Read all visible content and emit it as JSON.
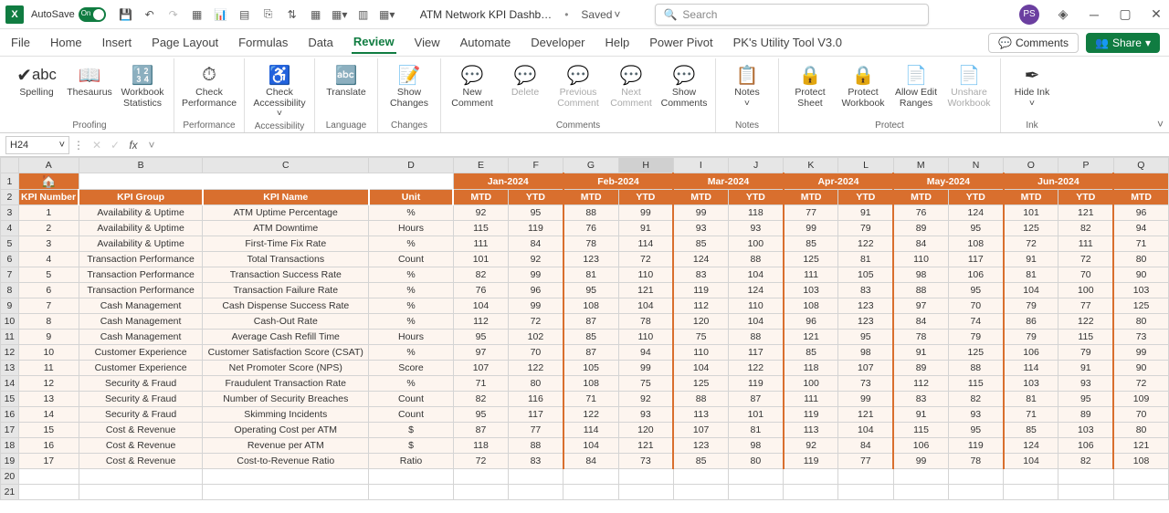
{
  "titlebar": {
    "autosave_label": "AutoSave",
    "autosave_on": "On",
    "doc_title": "ATM Network KPI Dashb…",
    "saved_status": "Saved",
    "search_placeholder": "Search",
    "avatar_initials": "PS"
  },
  "ribbon_tabs": [
    "File",
    "Home",
    "Insert",
    "Page Layout",
    "Formulas",
    "Data",
    "Review",
    "View",
    "Automate",
    "Developer",
    "Help",
    "Power Pivot",
    "PK's Utility Tool V3.0"
  ],
  "ribbon_active_tab": "Review",
  "ribbon_right": {
    "comments": "Comments",
    "share": "Share"
  },
  "ribbon_groups": {
    "proofing": {
      "label": "Proofing",
      "spelling": "Spelling",
      "thesaurus": "Thesaurus",
      "wbstats": "Workbook Statistics"
    },
    "performance": {
      "label": "Performance",
      "check_perf": "Check Performance"
    },
    "accessibility": {
      "label": "Accessibility",
      "check_acc": "Check Accessibility"
    },
    "language": {
      "label": "Language",
      "translate": "Translate"
    },
    "changes": {
      "label": "Changes",
      "show_changes": "Show Changes"
    },
    "comments": {
      "label": "Comments",
      "new": "New Comment",
      "delete": "Delete",
      "prev": "Previous Comment",
      "next": "Next Comment",
      "show": "Show Comments"
    },
    "notes": {
      "label": "Notes",
      "notes": "Notes"
    },
    "protect": {
      "label": "Protect",
      "sheet": "Protect Sheet",
      "workbook": "Protect Workbook",
      "ranges": "Allow Edit Ranges",
      "unshare": "Unshare Workbook"
    },
    "ink": {
      "label": "Ink",
      "hide": "Hide Ink"
    }
  },
  "formula_bar": {
    "name_box": "H24",
    "formula": ""
  },
  "columns": [
    "A",
    "B",
    "C",
    "D",
    "E",
    "F",
    "G",
    "H",
    "I",
    "J",
    "K",
    "L",
    "M",
    "N",
    "O",
    "P",
    "Q"
  ],
  "active_column": "H",
  "months": [
    "Jan-2024",
    "Feb-2024",
    "Mar-2024",
    "Apr-2024",
    "May-2024",
    "Jun-2024"
  ],
  "sub_headers": {
    "mtd": "MTD",
    "ytd": "YTD"
  },
  "headers": {
    "kpi_number": "KPI Number",
    "kpi_group": "KPI Group",
    "kpi_name": "KPI Name",
    "unit": "Unit"
  },
  "rows": [
    {
      "n": 1,
      "num": "1",
      "group": "Availability & Uptime",
      "name": "ATM Uptime Percentage",
      "unit": "%",
      "v": [
        "92",
        "95",
        "88",
        "99",
        "99",
        "118",
        "77",
        "91",
        "76",
        "124",
        "101",
        "121",
        "96"
      ]
    },
    {
      "n": 2,
      "num": "2",
      "group": "Availability & Uptime",
      "name": "ATM Downtime",
      "unit": "Hours",
      "v": [
        "115",
        "119",
        "76",
        "91",
        "93",
        "93",
        "99",
        "79",
        "89",
        "95",
        "125",
        "82",
        "94"
      ]
    },
    {
      "n": 3,
      "num": "3",
      "group": "Availability & Uptime",
      "name": "First-Time Fix Rate",
      "unit": "%",
      "v": [
        "111",
        "84",
        "78",
        "114",
        "85",
        "100",
        "85",
        "122",
        "84",
        "108",
        "72",
        "111",
        "71"
      ]
    },
    {
      "n": 4,
      "num": "4",
      "group": "Transaction Performance",
      "name": "Total Transactions",
      "unit": "Count",
      "v": [
        "101",
        "92",
        "123",
        "72",
        "124",
        "88",
        "125",
        "81",
        "110",
        "117",
        "91",
        "72",
        "80"
      ]
    },
    {
      "n": 5,
      "num": "5",
      "group": "Transaction Performance",
      "name": "Transaction Success Rate",
      "unit": "%",
      "v": [
        "82",
        "99",
        "81",
        "110",
        "83",
        "104",
        "111",
        "105",
        "98",
        "106",
        "81",
        "70",
        "90"
      ]
    },
    {
      "n": 6,
      "num": "6",
      "group": "Transaction Performance",
      "name": "Transaction Failure Rate",
      "unit": "%",
      "v": [
        "76",
        "96",
        "95",
        "121",
        "119",
        "124",
        "103",
        "83",
        "88",
        "95",
        "104",
        "100",
        "103"
      ]
    },
    {
      "n": 7,
      "num": "7",
      "group": "Cash Management",
      "name": "Cash Dispense Success Rate",
      "unit": "%",
      "v": [
        "104",
        "99",
        "108",
        "104",
        "112",
        "110",
        "108",
        "123",
        "97",
        "70",
        "79",
        "77",
        "125"
      ]
    },
    {
      "n": 8,
      "num": "8",
      "group": "Cash Management",
      "name": "Cash-Out Rate",
      "unit": "%",
      "v": [
        "112",
        "72",
        "87",
        "78",
        "120",
        "104",
        "96",
        "123",
        "84",
        "74",
        "86",
        "122",
        "80"
      ]
    },
    {
      "n": 9,
      "num": "9",
      "group": "Cash Management",
      "name": "Average Cash Refill Time",
      "unit": "Hours",
      "v": [
        "95",
        "102",
        "85",
        "110",
        "75",
        "88",
        "121",
        "95",
        "78",
        "79",
        "79",
        "115",
        "73"
      ]
    },
    {
      "n": 10,
      "num": "10",
      "group": "Customer Experience",
      "name": "Customer Satisfaction Score (CSAT)",
      "unit": "%",
      "v": [
        "97",
        "70",
        "87",
        "94",
        "110",
        "117",
        "85",
        "98",
        "91",
        "125",
        "106",
        "79",
        "99"
      ]
    },
    {
      "n": 11,
      "num": "11",
      "group": "Customer Experience",
      "name": "Net Promoter Score (NPS)",
      "unit": "Score",
      "v": [
        "107",
        "122",
        "105",
        "99",
        "104",
        "122",
        "118",
        "107",
        "89",
        "88",
        "114",
        "91",
        "90"
      ]
    },
    {
      "n": 12,
      "num": "12",
      "group": "Security & Fraud",
      "name": "Fraudulent Transaction Rate",
      "unit": "%",
      "v": [
        "71",
        "80",
        "108",
        "75",
        "125",
        "119",
        "100",
        "73",
        "112",
        "115",
        "103",
        "93",
        "72"
      ]
    },
    {
      "n": 13,
      "num": "13",
      "group": "Security & Fraud",
      "name": "Number of Security Breaches",
      "unit": "Count",
      "v": [
        "82",
        "116",
        "71",
        "92",
        "88",
        "87",
        "111",
        "99",
        "83",
        "82",
        "81",
        "95",
        "109"
      ]
    },
    {
      "n": 14,
      "num": "14",
      "group": "Security & Fraud",
      "name": "Skimming Incidents",
      "unit": "Count",
      "v": [
        "95",
        "117",
        "122",
        "93",
        "113",
        "101",
        "119",
        "121",
        "91",
        "93",
        "71",
        "89",
        "70"
      ]
    },
    {
      "n": 15,
      "num": "15",
      "group": "Cost & Revenue",
      "name": "Operating Cost per ATM",
      "unit": "$",
      "v": [
        "87",
        "77",
        "114",
        "120",
        "107",
        "81",
        "113",
        "104",
        "115",
        "95",
        "85",
        "103",
        "80"
      ]
    },
    {
      "n": 16,
      "num": "16",
      "group": "Cost & Revenue",
      "name": "Revenue per ATM",
      "unit": "$",
      "v": [
        "118",
        "88",
        "104",
        "121",
        "123",
        "98",
        "92",
        "84",
        "106",
        "119",
        "124",
        "106",
        "121"
      ]
    },
    {
      "n": 17,
      "num": "17",
      "group": "Cost & Revenue",
      "name": "Cost-to-Revenue Ratio",
      "unit": "Ratio",
      "v": [
        "72",
        "83",
        "84",
        "73",
        "85",
        "80",
        "119",
        "77",
        "99",
        "78",
        "104",
        "82",
        "108"
      ]
    }
  ],
  "empty_rows": [
    20,
    21
  ]
}
